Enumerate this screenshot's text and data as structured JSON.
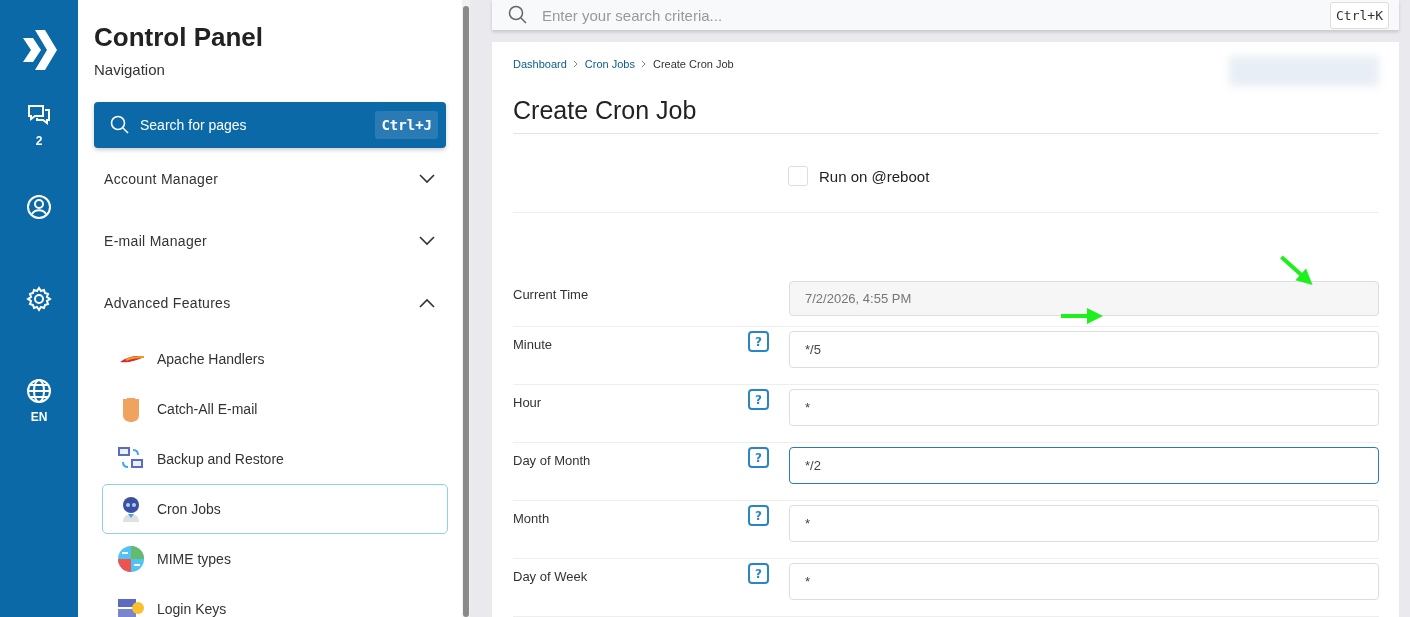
{
  "rail": {
    "items": [
      {
        "kind": "chat",
        "label": "2"
      },
      {
        "kind": "user"
      },
      {
        "kind": "settings"
      },
      {
        "kind": "globe",
        "label": "EN"
      }
    ]
  },
  "sidebar": {
    "title": "Control Panel",
    "subtitle": "Navigation",
    "search": {
      "placeholder": "Search for pages",
      "shortcut": "Ctrl+J"
    },
    "sections": [
      {
        "label": "Account Manager",
        "expanded": false
      },
      {
        "label": "E-mail Manager",
        "expanded": false
      },
      {
        "label": "Advanced Features",
        "expanded": true,
        "items": [
          {
            "label": "Apache Handlers",
            "kind": "feather",
            "selected": false
          },
          {
            "label": "Catch-All E-mail",
            "kind": "hand",
            "selected": false
          },
          {
            "label": "Backup and Restore",
            "kind": "monitors",
            "selected": false
          },
          {
            "label": "Cron Jobs",
            "kind": "robot",
            "selected": true
          },
          {
            "label": "MIME types",
            "kind": "mime",
            "selected": false
          },
          {
            "label": "Login Keys",
            "kind": "key",
            "selected": false
          }
        ]
      }
    ]
  },
  "topbar": {
    "search": {
      "placeholder": "Enter your search criteria...",
      "shortcut": "Ctrl+K"
    }
  },
  "breadcrumb": [
    {
      "label": "Dashboard",
      "kind": "link"
    },
    {
      "label": "Cron Jobs",
      "kind": "link"
    },
    {
      "label": "Create Cron Job",
      "kind": "current"
    }
  ],
  "page_title": "Create Cron Job",
  "reboot": {
    "label": "Run on @reboot",
    "checked": false
  },
  "fields": [
    {
      "label": "Current Time",
      "value": "7/2/2026, 4:55 PM",
      "disabled": true,
      "focused": false
    },
    {
      "label": "Minute",
      "value": "*/5",
      "disabled": false,
      "help": "?",
      "focused": false
    },
    {
      "label": "Hour",
      "value": "*",
      "disabled": false,
      "help": "?",
      "focused": false
    },
    {
      "label": "Day of Month",
      "value": "*/2",
      "disabled": false,
      "help": "?",
      "focused": true
    },
    {
      "label": "Month",
      "value": "*",
      "disabled": false,
      "help": "?",
      "focused": false
    },
    {
      "label": "Day of Week",
      "value": "*",
      "disabled": false,
      "help": "?",
      "focused": false
    }
  ]
}
